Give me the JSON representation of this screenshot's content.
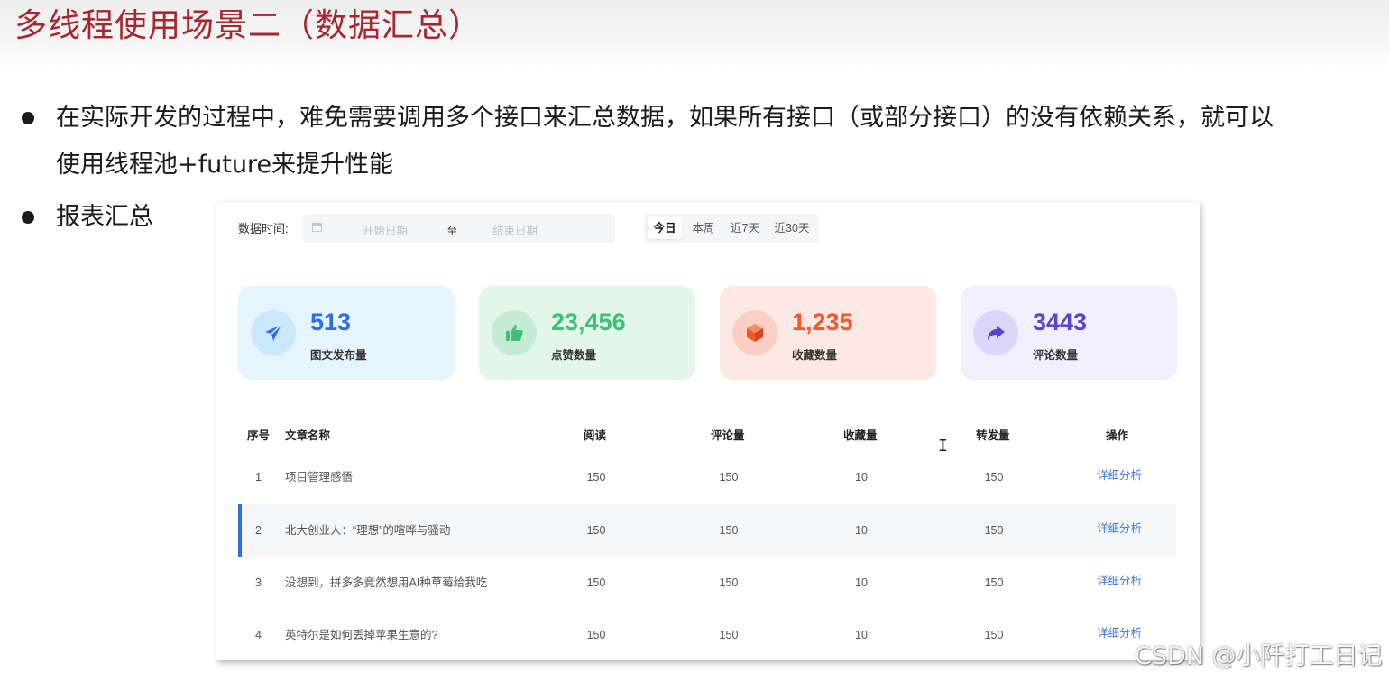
{
  "slide": {
    "title": "多线程使用场景二（数据汇总）",
    "bullets": [
      "在实际开发的过程中，难免需要调用多个接口来汇总数据，如果所有接口（或部分接口）的没有依赖关系，就可以",
      "使用线程池+future来提升性能",
      "报表汇总"
    ]
  },
  "filter": {
    "label": "数据时间:",
    "start_placeholder": "开始日期",
    "separator": "至",
    "end_placeholder": "结束日期",
    "ranges": [
      "今日",
      "本周",
      "近7天",
      "近30天"
    ],
    "active_range": "今日"
  },
  "stats": [
    {
      "value": "513",
      "label": "图文发布量",
      "icon": "paper-plane-icon",
      "color": "#2f6ee6",
      "bg": "#e6f4fe",
      "icon_bg": "#cbe7fd"
    },
    {
      "value": "23,456",
      "label": "点赞数量",
      "icon": "thumbs-up-icon",
      "color": "#3fbf78",
      "bg": "#e3f6ea",
      "icon_bg": "#c4ebd3"
    },
    {
      "value": "1,235",
      "label": "收藏数量",
      "icon": "cube-icon",
      "color": "#f0582e",
      "bg": "#fde9e4",
      "icon_bg": "#fbd0c4"
    },
    {
      "value": "3443",
      "label": "评论数量",
      "icon": "share-arrow-icon",
      "color": "#5b45c8",
      "bg": "#f1effd",
      "icon_bg": "#dcd6f8"
    }
  ],
  "table": {
    "headers": [
      "序号",
      "文章名称",
      "阅读",
      "评论量",
      "收藏量",
      "转发量",
      "操作"
    ],
    "rows": [
      [
        "1",
        "项目管理感悟",
        "150",
        "150",
        "10",
        "150",
        "详细分析"
      ],
      [
        "2",
        "北大创业人：“理想”的喧哗与骚动",
        "150",
        "150",
        "10",
        "150",
        "详细分析"
      ],
      [
        "3",
        "没想到，拼多多竟然想用AI种草莓给我吃",
        "150",
        "150",
        "10",
        "150",
        "详细分析"
      ],
      [
        "4",
        "英特尔是如何丢掉苹果生意的?",
        "150",
        "150",
        "10",
        "150",
        "详细分析"
      ]
    ],
    "highlighted_row": 2
  },
  "watermark": "CSDN @小阡打工日记",
  "colors": {
    "title": "#a8262d",
    "link": "#3a78e7",
    "highlight_bar": "#2f6ee6"
  }
}
